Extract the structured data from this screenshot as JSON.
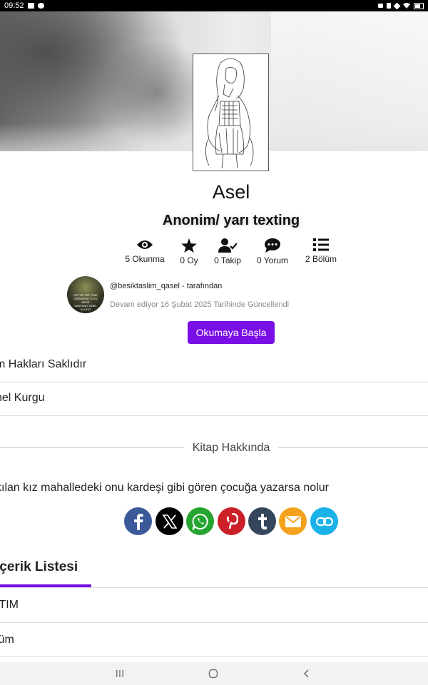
{
  "status_bar": {
    "time": "09:52"
  },
  "book": {
    "title": "Asel",
    "subtitle": "Anonim/ yarı texting"
  },
  "stats": [
    {
      "icon": "eye-icon",
      "label": "5 Okunma"
    },
    {
      "icon": "star-icon",
      "label": "0 Oy"
    },
    {
      "icon": "user-check-icon",
      "label": "0 Takip"
    },
    {
      "icon": "comment-icon",
      "label": "0 Yorum"
    },
    {
      "icon": "list-icon",
      "label": "2 Bölüm"
    }
  ],
  "author": {
    "handle": "@besiktaslim_qasel - tarafından",
    "updated": "Devam ediyor 16 Şubat 2025 Tarihinde Güncellendi"
  },
  "read_button": "Okumaya Başla",
  "info_rows": [
    "m Hakları Saklıdır",
    "nel Kurgu"
  ],
  "about": {
    "title": "Kitap Hakkında",
    "description": "kılan kız mahalledeki onu kardeşi gibi gören çocuğa yazarsa nolur"
  },
  "share": [
    {
      "icon": "facebook-icon",
      "color": "#3b5998"
    },
    {
      "icon": "x-icon",
      "color": "#000000"
    },
    {
      "icon": "whatsapp-icon",
      "color": "#25a52f"
    },
    {
      "icon": "pinterest-icon",
      "color": "#cb2027"
    },
    {
      "icon": "tumblr-icon",
      "color": "#35465c"
    },
    {
      "icon": "email-icon",
      "color": "#f4a21b"
    },
    {
      "icon": "link-icon",
      "color": "#1ab2e8"
    }
  ],
  "contents": {
    "tab_label": "İçerik Listesi",
    "items": [
      "ITIM",
      "lüm"
    ]
  },
  "colors": {
    "accent": "#7a0ee6"
  }
}
